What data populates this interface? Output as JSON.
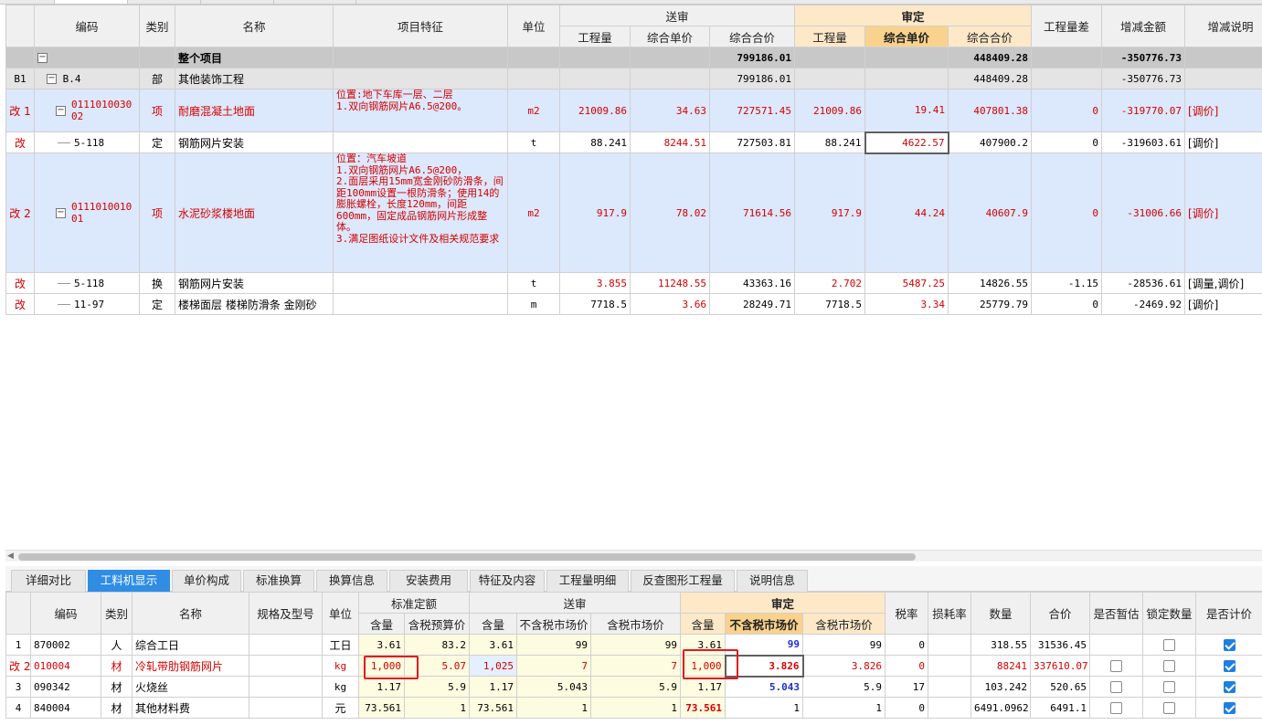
{
  "top": {
    "headers": {
      "code": "编码",
      "type": "类别",
      "name": "名称",
      "features": "项目特征",
      "unit": "单位",
      "submitted": "送审",
      "audited": "审定",
      "qty": "工程量",
      "unit_price": "综合单价",
      "total": "综合合价",
      "qty_diff": "工程量差",
      "change_amount": "增减金额",
      "change_note": "增减说明"
    },
    "rows": [
      {
        "kind": "total",
        "idx": "",
        "code": "",
        "type": "",
        "name": "整个项目",
        "features": "",
        "unit": "",
        "s_qty": "",
        "s_price": "",
        "s_total": "799186.01",
        "a_qty": "",
        "a_price": "",
        "a_total": "448409.28",
        "diff": "",
        "change": "-350776.73",
        "note": ""
      },
      {
        "kind": "sub",
        "idx": "B1",
        "code": "B.4",
        "type": "部",
        "name": "其他装饰工程",
        "features": "",
        "unit": "",
        "s_qty": "",
        "s_price": "",
        "s_total": "799186.01",
        "a_qty": "",
        "a_price": "",
        "a_total": "448409.28",
        "diff": "",
        "change": "-350776.73",
        "note": ""
      },
      {
        "kind": "item",
        "idx": "改 1",
        "code": "011101003002",
        "type": "项",
        "name": "耐磨混凝土地面",
        "features": "位置:地下车库一层、二层\n1.双向钢筋网片A6.5@200。",
        "unit": "m2",
        "s_qty": "21009.86",
        "s_price": "34.63",
        "s_total": "727571.45",
        "a_qty": "21009.86",
        "a_price": "19.41",
        "a_total": "407801.38",
        "diff": "0",
        "change": "-319770.07",
        "note": "[调价]"
      },
      {
        "kind": "child",
        "idx": "改",
        "code": "5-118",
        "type": "定",
        "name": "钢筋网片安装",
        "features": "",
        "unit": "t",
        "s_qty": "88.241",
        "s_price": "8244.51",
        "s_total": "727503.81",
        "a_qty": "88.241",
        "a_price": "4622.57",
        "a_total": "407900.2",
        "diff": "0",
        "change": "-319603.61",
        "note": "[调价]"
      },
      {
        "kind": "item",
        "idx": "改 2",
        "code": "011101001001",
        "type": "项",
        "name": "水泥砂浆楼地面",
        "features": "位置：汽车坡道\n1.双向钢筋网片A6.5@200，\n2.面层采用15mm宽金刚砂防滑条，间距100mm设置一根防滑条；使用14的膨胀螺栓，长度120mm，间距600mm，固定成品钢筋网片形成整体。\n3.满足图纸设计文件及相关规范要求",
        "unit": "m2",
        "s_qty": "917.9",
        "s_price": "78.02",
        "s_total": "71614.56",
        "a_qty": "917.9",
        "a_price": "44.24",
        "a_total": "40607.9",
        "diff": "0",
        "change": "-31006.66",
        "note": "[调价]"
      },
      {
        "kind": "child",
        "idx": "改",
        "code": "5-118",
        "type": "换",
        "name": "钢筋网片安装",
        "features": "",
        "unit": "t",
        "s_qty": "3.855",
        "s_price": "11248.55",
        "s_total": "43363.16",
        "a_qty": "2.702",
        "a_price": "5487.25",
        "a_total": "14826.55",
        "diff": "-1.15",
        "change": "-28536.61",
        "note": "[调量,调价]"
      },
      {
        "kind": "child",
        "idx": "改",
        "code": "11-97",
        "type": "定",
        "name": "楼梯面层 楼梯防滑条 金刚砂",
        "features": "",
        "unit": "m",
        "s_qty": "7718.5",
        "s_price": "3.66",
        "s_total": "28249.71",
        "a_qty": "7718.5",
        "a_price": "3.34",
        "a_total": "25779.79",
        "diff": "0",
        "change": "-2469.92",
        "note": "[调价]"
      }
    ]
  },
  "tabs": [
    "详细对比",
    "工料机显示",
    "单价构成",
    "标准换算",
    "换算信息",
    "安装费用",
    "特征及内容",
    "工程量明细",
    "反查图形工程量",
    "说明信息"
  ],
  "active_tab": "工料机显示",
  "bottom": {
    "headers": {
      "code": "编码",
      "type": "类别",
      "name": "名称",
      "spec": "规格及型号",
      "unit": "单位",
      "std_quota": "标准定额",
      "submitted": "送审",
      "audited": "审定",
      "content": "含量",
      "tax_budget_price": "含税预算价",
      "notax_market": "不含税市场价",
      "tax_market": "含税市场价",
      "tax_rate": "税率",
      "loss_rate": "损耗率",
      "quantity": "数量",
      "total": "合价",
      "is_provisional": "是否暂估",
      "lock_qty": "锁定数量",
      "is_priced": "是否计价"
    },
    "rows": [
      {
        "idx": "1",
        "code": "870002",
        "type": "人",
        "name": "综合工日",
        "spec": "",
        "unit": "工日",
        "std_content": "3.61",
        "std_price": "83.2",
        "s_content": "3.61",
        "s_notax": "99",
        "s_tax": "99",
        "a_content": "3.61",
        "a_notax": "99",
        "a_tax": "99",
        "tax_rate": "0",
        "loss": "",
        "qty": "318.55",
        "total": "31536.45",
        "provisional": null,
        "lock": false,
        "priced": true
      },
      {
        "idx": "改 2",
        "code": "010004",
        "type": "材",
        "name": "冷轧带肋钢筋网片",
        "spec": "",
        "unit": "kg",
        "std_content": "1,000",
        "std_price": "5.07",
        "s_content": "1,025",
        "s_notax": "7",
        "s_tax": "7",
        "a_content": "1,000",
        "a_notax": "3.826",
        "a_tax": "3.826",
        "tax_rate": "0",
        "loss": "",
        "qty": "88241",
        "total": "337610.07",
        "provisional": false,
        "lock": false,
        "priced": true
      },
      {
        "idx": "3",
        "code": "090342",
        "type": "材",
        "name": "火烧丝",
        "spec": "",
        "unit": "kg",
        "std_content": "1.17",
        "std_price": "5.9",
        "s_content": "1.17",
        "s_notax": "5.043",
        "s_tax": "5.9",
        "a_content": "1.17",
        "a_notax": "5.043",
        "a_tax": "5.9",
        "tax_rate": "17",
        "loss": "",
        "qty": "103.242",
        "total": "520.65",
        "provisional": false,
        "lock": false,
        "priced": true
      },
      {
        "idx": "4",
        "code": "840004",
        "type": "材",
        "name": "其他材料费",
        "spec": "",
        "unit": "元",
        "std_content": "73.561",
        "std_price": "1",
        "s_content": "73.561",
        "s_notax": "1",
        "s_tax": "1",
        "a_content": "73.561",
        "a_notax": "1",
        "a_tax": "1",
        "tax_rate": "0",
        "loss": "",
        "qty": "6491.0962",
        "total": "6491.1",
        "provisional": false,
        "lock": false,
        "priced": true
      }
    ]
  },
  "colors": {
    "accent": "#2f8de4",
    "changed_text": "#d40000",
    "audit_header": "#fde8c8",
    "highlight_box": "#e21b1b"
  }
}
